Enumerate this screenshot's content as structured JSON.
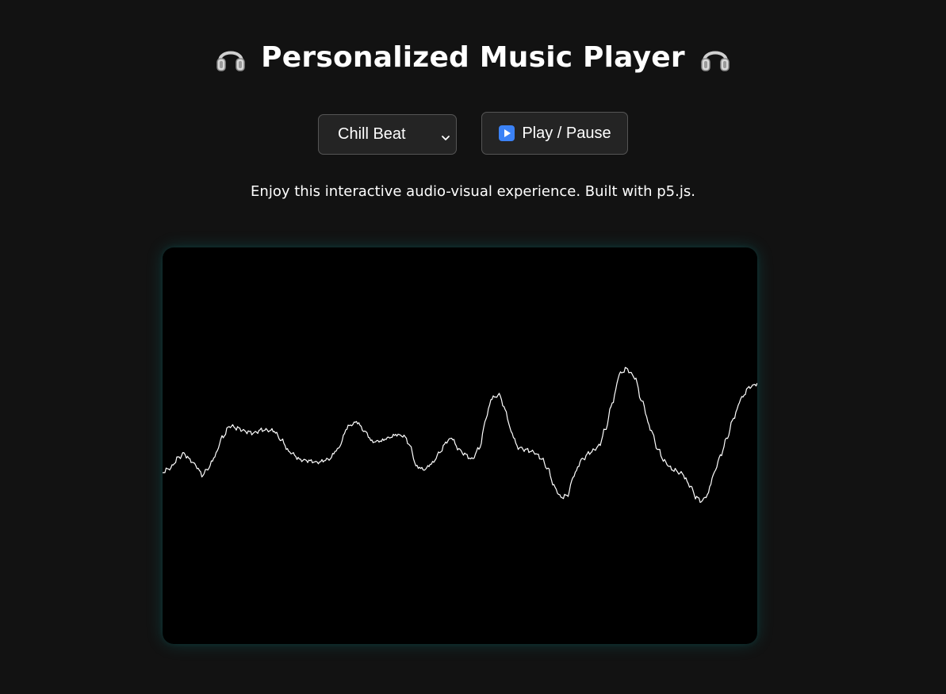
{
  "header": {
    "title": "Personalized Music Player",
    "left_icon": "headphones-icon",
    "right_icon": "headphones-icon"
  },
  "controls": {
    "track_select": {
      "selected": "Chill Beat"
    },
    "play_button": {
      "label": "Play / Pause",
      "icon": "play-icon"
    }
  },
  "description": "Enjoy this interactive audio-visual experience. Built with p5.js.",
  "colors": {
    "background": "#121212",
    "canvas": "#000000",
    "waveform": "#ffffff",
    "canvas_glow": "#00c8c8",
    "control_bg": "#242424",
    "play_icon": "#3b82f6"
  }
}
